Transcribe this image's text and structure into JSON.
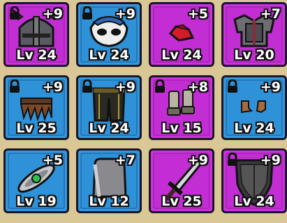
{
  "items": [
    {
      "name": "horned-helmet",
      "bonus": "+9",
      "level": "Lv 24",
      "rarity": "purple",
      "locked": true
    },
    {
      "name": "feather-mask",
      "bonus": "+9",
      "level": "Lv 24",
      "rarity": "blue",
      "locked": true
    },
    {
      "name": "red-hat",
      "bonus": "+5",
      "level": "Lv 24",
      "rarity": "purple",
      "locked": false
    },
    {
      "name": "plate-armor",
      "bonus": "+7",
      "level": "Lv 20",
      "rarity": "purple",
      "locked": false
    },
    {
      "name": "leather-skirt",
      "bonus": "+9",
      "level": "Lv 25",
      "rarity": "blue",
      "locked": true
    },
    {
      "name": "dark-leggings",
      "bonus": "+9",
      "level": "Lv 24",
      "rarity": "blue",
      "locked": true
    },
    {
      "name": "iron-greaves",
      "bonus": "+8",
      "level": "Lv 15",
      "rarity": "purple",
      "locked": true
    },
    {
      "name": "leather-boots",
      "bonus": "+9",
      "level": "Lv 24",
      "rarity": "blue",
      "locked": true
    },
    {
      "name": "gem-amulet",
      "bonus": "+5",
      "level": "Lv 19",
      "rarity": "blue",
      "locked": false
    },
    {
      "name": "stone-tablet",
      "bonus": "+7",
      "level": "Lv 12",
      "rarity": "blue",
      "locked": false
    },
    {
      "name": "steel-sword",
      "bonus": "+9",
      "level": "Lv 25",
      "rarity": "purple",
      "locked": false
    },
    {
      "name": "dark-shield",
      "bonus": "+9",
      "level": "Lv 24",
      "rarity": "purple",
      "locked": true
    }
  ],
  "colors": {
    "purple": "#cc33dd",
    "blue": "#3399dd",
    "background": "#d9c896"
  }
}
